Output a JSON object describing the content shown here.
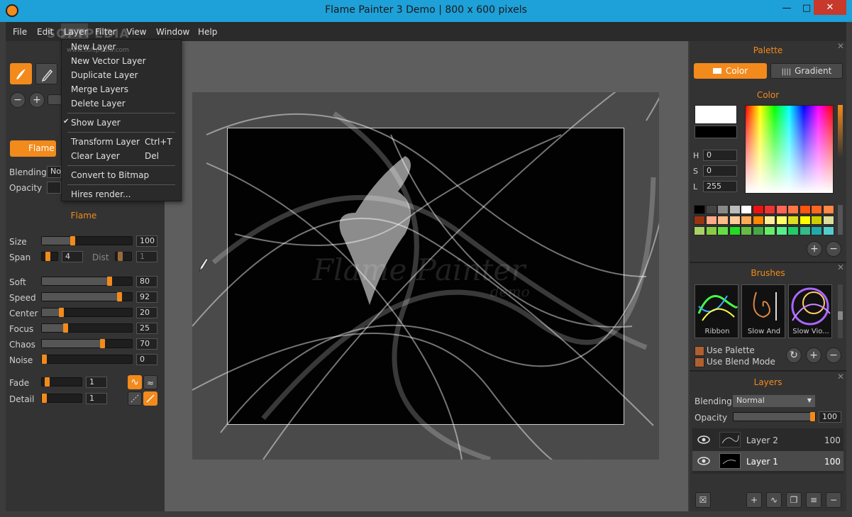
{
  "window": {
    "title": "Flame Painter 3 Demo | 800 x 600 pixels",
    "minimize": "—",
    "maximize": "□",
    "close": "✕"
  },
  "menu": [
    "File",
    "Edit",
    "Layer",
    "Filter",
    "View",
    "Window",
    "Help"
  ],
  "watermark": {
    "text": "SOFTPEDIA",
    "url": "www.softpedia.com"
  },
  "layer_menu": {
    "items": [
      "New Layer",
      "New Vector Layer",
      "Duplicate Layer",
      "Merge Layers",
      "Delete Layer",
      "Show Layer",
      "Transform Layer",
      "Clear Layer",
      "Convert to Bitmap",
      "Hires render..."
    ],
    "shortcuts": {
      "transform": "Ctrl+T",
      "clear": "Del"
    },
    "checkmark": "✔"
  },
  "left": {
    "flame_btn": "Flame",
    "blending_label": "Blending",
    "blending_value": "No",
    "opacity_label": "Opacity",
    "section_title": "Flame",
    "size": {
      "label": "Size",
      "value": "100",
      "level": 0.33
    },
    "span": {
      "label": "Span",
      "value": "4"
    },
    "dist": {
      "label": "Dist",
      "value": "1"
    },
    "sliders": [
      {
        "label": "Soft",
        "value": "80",
        "level": 0.77
      },
      {
        "label": "Speed",
        "value": "92",
        "level": 0.88
      },
      {
        "label": "Center",
        "value": "20",
        "level": 0.2
      },
      {
        "label": "Focus",
        "value": "25",
        "level": 0.25
      },
      {
        "label": "Chaos",
        "value": "70",
        "level": 0.68
      },
      {
        "label": "Noise",
        "value": "0",
        "level": 0.0
      }
    ],
    "fade": {
      "label": "Fade",
      "value": "1"
    },
    "detail": {
      "label": "Detail",
      "value": "1"
    }
  },
  "canvas": {
    "watermark_main": "Flame Painter",
    "watermark_sub": "demo"
  },
  "palette": {
    "title": "Palette",
    "color_tab": "Color",
    "gradient_tab": "Gradient",
    "color_title": "Color",
    "h_label": "H",
    "h_value": "0",
    "s_label": "S",
    "s_value": "0",
    "l_label": "L",
    "l_value": "255",
    "swatches": [
      "#000000",
      "#444444",
      "#888888",
      "#bbbbbb",
      "#ffffff",
      "#ee1111",
      "#ee3333",
      "#ff6655",
      "#ff7744",
      "#ff5511",
      "#ff6622",
      "#ff8844",
      "#993311",
      "#ffaa88",
      "#ffbb88",
      "#ffcc99",
      "#ffaa55",
      "#ff8800",
      "#ffee99",
      "#ffff66",
      "#dddd22",
      "#ffff00",
      "#cccc00",
      "#dddd99",
      "#aad066",
      "#88cc44",
      "#66dd44",
      "#22dd22",
      "#66bb44",
      "#44aa44",
      "#66ee66",
      "#55ee88",
      "#22cc66",
      "#33bb88",
      "#22aaaa",
      "#55cccc"
    ]
  },
  "brushes": {
    "title": "Brushes",
    "items": [
      "Ribbon",
      "Slow And",
      "Slow Vio..."
    ],
    "use_palette": "Use Palette",
    "use_blend": "Use Blend Mode"
  },
  "layers": {
    "title": "Layers",
    "blending_label": "Blending",
    "blending_value": "Normal",
    "opacity_label": "Opacity",
    "opacity_value": "100",
    "rows": [
      {
        "name": "Layer 2",
        "opacity": "100"
      },
      {
        "name": "Layer 1",
        "opacity": "100"
      }
    ]
  }
}
